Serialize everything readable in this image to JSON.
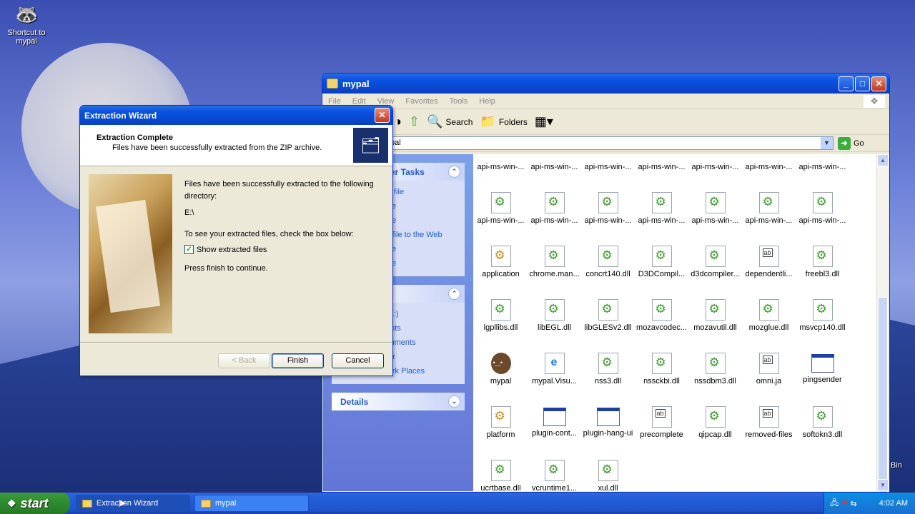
{
  "desktop": {
    "shortcut_label": "Shortcut to mypal",
    "bin_label": "Bin"
  },
  "explorer": {
    "title": "mypal",
    "menu": [
      "File",
      "Edit",
      "View",
      "Favorites",
      "Tools",
      "Help"
    ],
    "toolbar": {
      "search": "Search",
      "folders": "Folders"
    },
    "address_value": "pal",
    "go_label": "Go",
    "sidebar": {
      "file_tasks_title": "er Tasks",
      "file_tasks": [
        "is file",
        "file",
        "file",
        "s file to the Web",
        "file",
        "file"
      ],
      "other_places_title": "",
      "other_places": [
        "(E:)",
        "ents",
        "cuments",
        "ter",
        "My Network Places"
      ],
      "details_title": "Details"
    },
    "files": [
      {
        "name": "api-ms-win-...",
        "type": "dll"
      },
      {
        "name": "api-ms-win-...",
        "type": "dll"
      },
      {
        "name": "api-ms-win-...",
        "type": "dll"
      },
      {
        "name": "api-ms-win-...",
        "type": "dll"
      },
      {
        "name": "api-ms-win-...",
        "type": "dll"
      },
      {
        "name": "api-ms-win-...",
        "type": "dll"
      },
      {
        "name": "api-ms-win-...",
        "type": "dll"
      },
      {
        "name": "api-ms-win-...",
        "type": "dll"
      },
      {
        "name": "api-ms-win-...",
        "type": "dll"
      },
      {
        "name": "api-ms-win-...",
        "type": "dll"
      },
      {
        "name": "api-ms-win-...",
        "type": "dll"
      },
      {
        "name": "api-ms-win-...",
        "type": "dll"
      },
      {
        "name": "api-ms-win-...",
        "type": "dll"
      },
      {
        "name": "api-ms-win-...",
        "type": "dll"
      },
      {
        "name": "application",
        "type": "app"
      },
      {
        "name": "chrome.man...",
        "type": "dll"
      },
      {
        "name": "concrt140.dll",
        "type": "dll"
      },
      {
        "name": "D3DCompil...",
        "type": "dll"
      },
      {
        "name": "d3dcompiler...",
        "type": "dll"
      },
      {
        "name": "dependentli...",
        "type": "doc"
      },
      {
        "name": "freebl3.dll",
        "type": "dll"
      },
      {
        "name": "lgpllibs.dll",
        "type": "dll"
      },
      {
        "name": "libEGL.dll",
        "type": "dll"
      },
      {
        "name": "libGLESv2.dll",
        "type": "dll"
      },
      {
        "name": "mozavcodec...",
        "type": "dll"
      },
      {
        "name": "mozavutil.dll",
        "type": "dll"
      },
      {
        "name": "mozglue.dll",
        "type": "dll"
      },
      {
        "name": "msvcp140.dll",
        "type": "dll"
      },
      {
        "name": "mypal",
        "type": "raccoon"
      },
      {
        "name": "mypal.Visu...",
        "type": "web"
      },
      {
        "name": "nss3.dll",
        "type": "dll"
      },
      {
        "name": "nssckbi.dll",
        "type": "dll"
      },
      {
        "name": "nssdbm3.dll",
        "type": "dll"
      },
      {
        "name": "omni.ja",
        "type": "doc"
      },
      {
        "name": "pingsender",
        "type": "exe"
      },
      {
        "name": "platform",
        "type": "app"
      },
      {
        "name": "plugin-cont...",
        "type": "exe"
      },
      {
        "name": "plugin-hang-ui",
        "type": "exe"
      },
      {
        "name": "precomplete",
        "type": "doc"
      },
      {
        "name": "qipcap.dll",
        "type": "dll"
      },
      {
        "name": "removed-files",
        "type": "doc"
      },
      {
        "name": "softokn3.dll",
        "type": "dll"
      },
      {
        "name": "ucrtbase.dll",
        "type": "dll"
      },
      {
        "name": "vcruntime1...",
        "type": "dll"
      },
      {
        "name": "xul.dll",
        "type": "dll"
      }
    ]
  },
  "dialog": {
    "title": "Extraction Wizard",
    "header_title": "Extraction Complete",
    "header_subtitle": "Files have been successfully extracted from the ZIP archive.",
    "body_line1": "Files have been successfully extracted to the following directory:",
    "directory": "E:\\",
    "instruction": "To see your extracted files, check the box below:",
    "checkbox_label": "Show extracted files",
    "checkbox_checked": true,
    "continue_text": "Press finish to continue.",
    "back_label": "< Back",
    "finish_label": "Finish",
    "cancel_label": "Cancel"
  },
  "taskbar": {
    "start_label": "start",
    "tasks": [
      "Extraction Wizard",
      "mypal"
    ],
    "clock": "4:02 AM"
  }
}
